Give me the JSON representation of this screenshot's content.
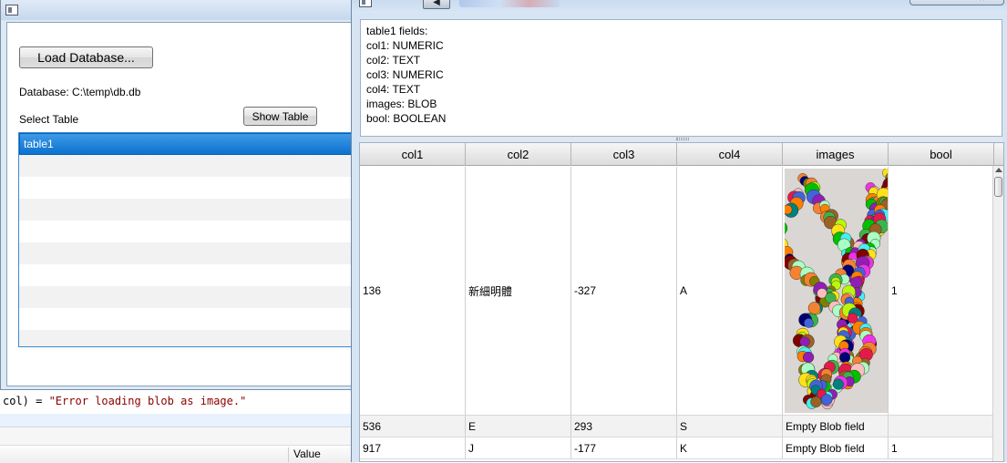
{
  "background_ide": {
    "code_line_prefix": "col) = ",
    "code_line_string": "\"Error loading blob as image.\"",
    "watch_value_header": "Value"
  },
  "left_window": {
    "load_button_label": "Load Database...",
    "database_label": "Database: C:\\temp\\db.db",
    "select_table_label": "Select Table",
    "show_table_button_label": "Show Table",
    "tables": [
      "table1"
    ],
    "selected_table": "table1"
  },
  "right_window": {
    "fields_text": [
      "table1 fields:",
      "col1: NUMERIC",
      "col2: TEXT",
      "col3: NUMERIC",
      "col4: TEXT",
      "images: BLOB",
      "bool: BOOLEAN"
    ],
    "grid": {
      "columns": [
        "col1",
        "col2",
        "col3",
        "col4",
        "images",
        "bool"
      ],
      "rows": [
        {
          "col1": "136",
          "col2": "新細明體",
          "col3": "-327",
          "col4": "A",
          "images": "",
          "bool": "1"
        },
        {
          "col1": "536",
          "col2": "E",
          "col3": "293",
          "col4": "S",
          "images": "Empty Blob field",
          "bool": ""
        },
        {
          "col1": "917",
          "col2": "J",
          "col3": "-177",
          "col4": "K",
          "images": "Empty Blob field",
          "bool": "1"
        }
      ]
    }
  },
  "icons": [
    "window-system-icon",
    "back-arrow-icon",
    "minimize-icon",
    "maximize-icon",
    "close-icon",
    "scroll-up-arrow-icon"
  ]
}
